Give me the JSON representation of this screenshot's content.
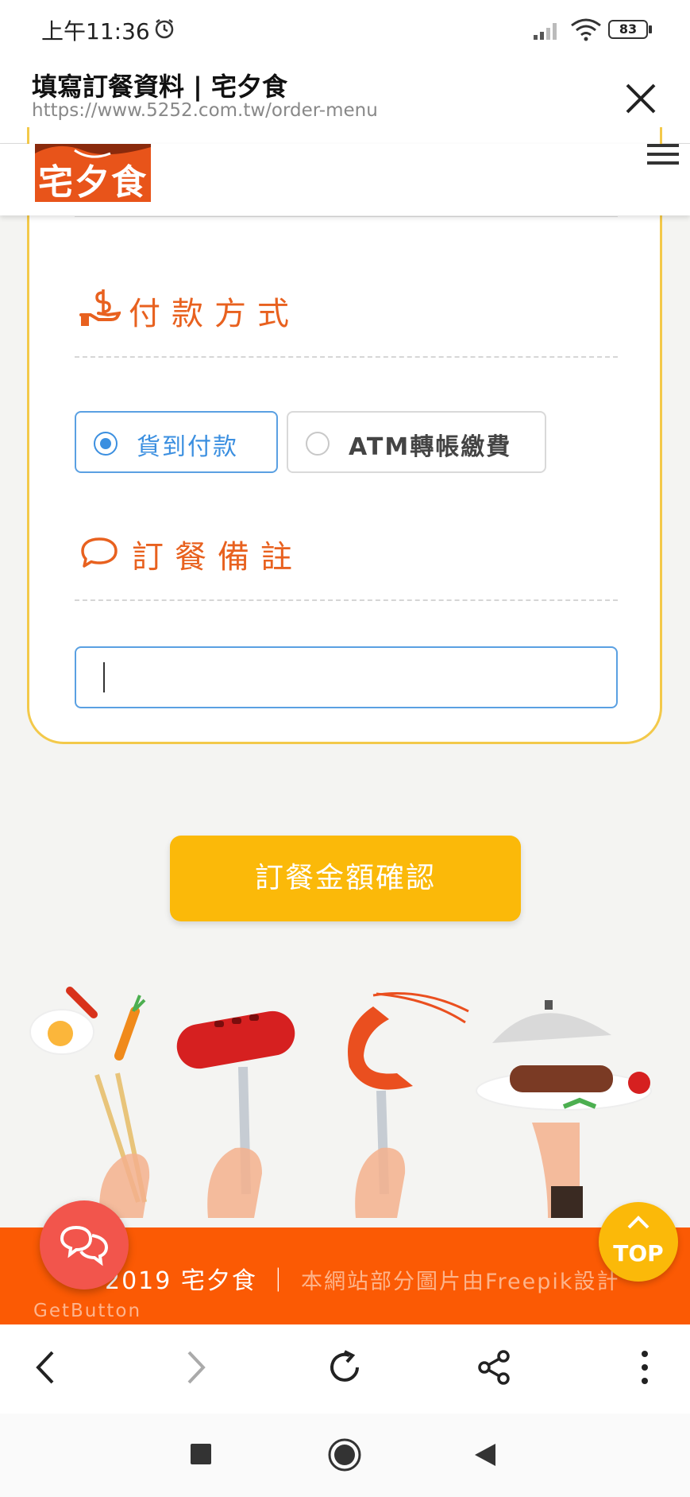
{
  "status_bar": {
    "time": "上午11:36",
    "battery": "83",
    "alarm_icon": "alarm-icon",
    "signal_icon": "signal-icon",
    "wifi_icon": "wifi-icon"
  },
  "browser": {
    "title": "填寫訂餐資料 | 宅夕食",
    "url": "https://www.5252.com.tw/order-menu",
    "close_icon": "close-icon"
  },
  "site": {
    "logo_text": "宅夕食",
    "menu_icon": "hamburger-menu-icon"
  },
  "payment": {
    "title": "付款方式",
    "icon": "hand-money-icon",
    "options": [
      {
        "label": "貨到付款",
        "selected": true
      },
      {
        "label": "ATM轉帳繳費",
        "selected": false
      }
    ]
  },
  "notes": {
    "title": "訂餐備註",
    "icon": "speech-bubble-icon",
    "value": ""
  },
  "confirm_button": "訂餐金額確認",
  "footer": {
    "copyright": "2019 宅夕食 ｜",
    "credit": "本網站部分圖片由Freepik設計",
    "getbutton": "GetButton",
    "top_label": "TOP"
  },
  "colors": {
    "accent_orange": "#e8611f",
    "footer_orange": "#fb5a04",
    "button_yellow": "#fbb909",
    "selected_blue": "#3b8fe0"
  }
}
